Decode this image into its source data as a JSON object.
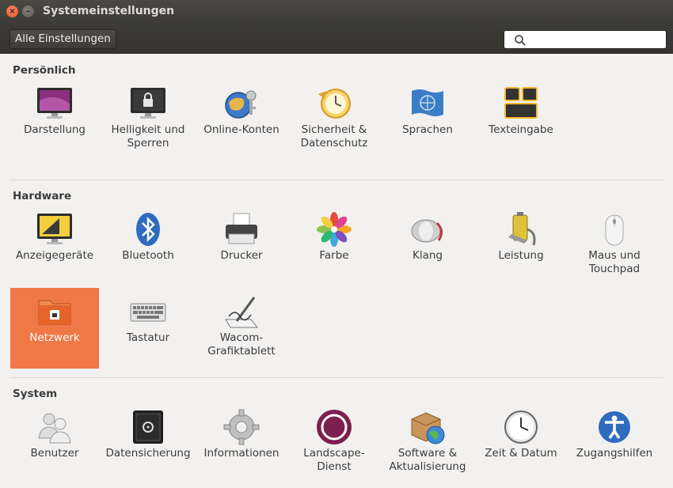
{
  "window": {
    "title": "Systemeinstellungen",
    "close_glyph": "×",
    "minimize_glyph": "–"
  },
  "toolbar": {
    "all_settings_label": "Alle Einstellungen",
    "search_placeholder": "",
    "search_icon": "search-icon"
  },
  "sections": {
    "personal": {
      "title": "Persönlich",
      "items": [
        {
          "label": "Darstellung",
          "icon": "appearance-icon"
        },
        {
          "label": "Helligkeit und\nSperren",
          "icon": "brightness-lock-icon"
        },
        {
          "label": "Online-Konten",
          "icon": "online-accounts-icon"
        },
        {
          "label": "Sicherheit &\nDatenschutz",
          "icon": "security-privacy-icon"
        },
        {
          "label": "Sprachen",
          "icon": "language-icon"
        },
        {
          "label": "Texteingabe",
          "icon": "text-entry-icon"
        }
      ]
    },
    "hardware": {
      "title": "Hardware",
      "items": [
        {
          "label": "Anzeigegeräte",
          "icon": "displays-icon"
        },
        {
          "label": "Bluetooth",
          "icon": "bluetooth-icon"
        },
        {
          "label": "Drucker",
          "icon": "printer-icon"
        },
        {
          "label": "Farbe",
          "icon": "color-icon"
        },
        {
          "label": "Klang",
          "icon": "sound-icon"
        },
        {
          "label": "Leistung",
          "icon": "power-icon"
        },
        {
          "label": "Maus und\nTouchpad",
          "icon": "mouse-icon"
        },
        {
          "label": "Netzwerk",
          "icon": "network-icon",
          "selected": true
        },
        {
          "label": "Tastatur",
          "icon": "keyboard-icon"
        },
        {
          "label": "Wacom-\nGrafiktablett",
          "icon": "wacom-icon"
        }
      ]
    },
    "system": {
      "title": "System",
      "items": [
        {
          "label": "Benutzer",
          "icon": "users-icon"
        },
        {
          "label": "Datensicherung",
          "icon": "backup-icon"
        },
        {
          "label": "Informationen",
          "icon": "details-icon"
        },
        {
          "label": "Landscape-\nDienst",
          "icon": "landscape-icon"
        },
        {
          "label": "Software &\nAktualisierung",
          "icon": "software-update-icon"
        },
        {
          "label": "Zeit & Datum",
          "icon": "clock-icon"
        },
        {
          "label": "Zugangshilfen",
          "icon": "accessibility-icon"
        }
      ]
    }
  },
  "colors": {
    "selection": "#f07746",
    "titlebar": "#3c3b37",
    "background": "#f2f1f0"
  }
}
